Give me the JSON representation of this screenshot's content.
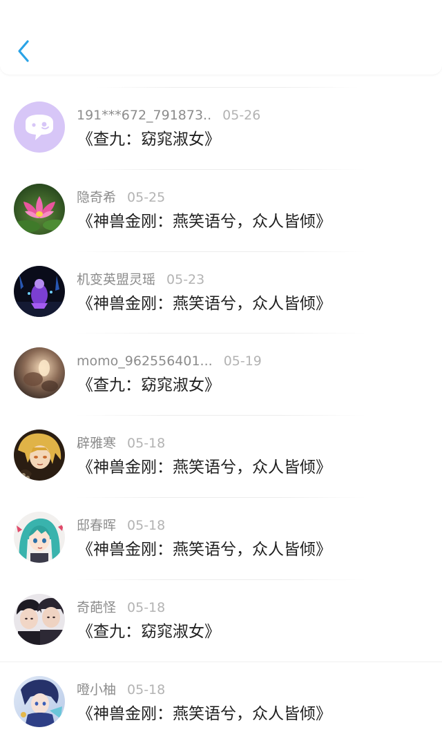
{
  "header": {
    "back_icon": "chevron-left-icon",
    "accent_color": "#2aa3e6"
  },
  "items": [
    {
      "user": "191***672_791873..",
      "date": "05-26",
      "title": "《查九：窈窕淑女》",
      "avatar": "default-chat-avatar"
    },
    {
      "user": "隐奇希",
      "date": "05-25",
      "title": "《神兽金刚：燕笑语兮，众人皆倾》",
      "avatar": "lotus-flower-avatar"
    },
    {
      "user": "机变英盟灵瑶",
      "date": "05-23",
      "title": "《神兽金刚：燕笑语兮，众人皆倾》",
      "avatar": "game-character-avatar"
    },
    {
      "user": "momo_962556401...",
      "date": "05-19",
      "title": "《查九：窈窕淑女》",
      "avatar": "photo-avatar"
    },
    {
      "user": "辟雅寒",
      "date": "05-18",
      "title": "《神兽金刚：燕笑语兮，众人皆倾》",
      "avatar": "anime-blonde-avatar"
    },
    {
      "user": "邸春晖",
      "date": "05-18",
      "title": "《神兽金刚：燕笑语兮，众人皆倾》",
      "avatar": "anime-teal-hair-avatar"
    },
    {
      "user": "奇葩怪",
      "date": "05-18",
      "title": "《查九：窈窕淑女》",
      "avatar": "two-people-avatar"
    },
    {
      "user": "噔小柚",
      "date": "05-18",
      "title": "《神兽金刚：燕笑语兮，众人皆倾》",
      "avatar": "anime-character-avatar"
    }
  ]
}
